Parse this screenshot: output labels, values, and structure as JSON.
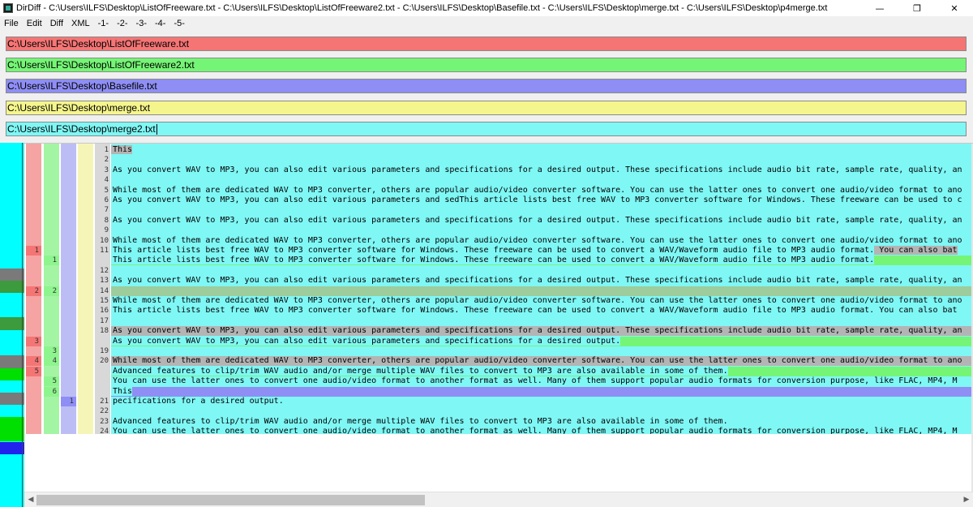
{
  "window": {
    "title": "DirDiff - C:\\Users\\ILFS\\Desktop\\ListOfFreeware.txt - C:\\Users\\ILFS\\Desktop\\ListOfFreeware2.txt - C:\\Users\\ILFS\\Desktop\\Basefile.txt - C:\\Users\\ILFS\\Desktop\\merge.txt - C:\\Users\\ILFS\\Desktop\\p4merge.txt",
    "minimize": "—",
    "restore": "❐",
    "close": "✕"
  },
  "menu": {
    "file": "File",
    "edit": "Edit",
    "diff": "Diff",
    "xml": "XML",
    "m1": "-1-",
    "m2": "-2-",
    "m3": "-3-",
    "m4": "-4-",
    "m5": "-5-"
  },
  "paths": {
    "p1": "C:\\Users\\ILFS\\Desktop\\ListOfFreeware.txt",
    "p2": "C:\\Users\\ILFS\\Desktop\\ListOfFreeware2.txt",
    "p3": "C:\\Users\\ILFS\\Desktop\\Basefile.txt",
    "p4": "C:\\Users\\ILFS\\Desktop\\merge.txt",
    "p5": "C:\\Users\\ILFS\\Desktop\\merge2.txt"
  },
  "colors": {
    "file1": "#f57575",
    "file2": "#75f575",
    "file3": "#8e8ef5",
    "file4": "#f5f58e",
    "file5": "#7ff7f5"
  },
  "gutter1": [
    {
      "row": 10,
      "num": "1"
    },
    {
      "row": 14,
      "num": "2"
    },
    {
      "row": 19,
      "num": "3"
    },
    {
      "row": 21,
      "num": "4"
    },
    {
      "row": 22,
      "num": "5"
    }
  ],
  "gutter2": [
    {
      "row": 11,
      "num": "1"
    },
    {
      "row": 14,
      "num": "2"
    },
    {
      "row": 20,
      "num": "3"
    },
    {
      "row": 21,
      "num": "4"
    },
    {
      "row": 23,
      "num": "5"
    },
    {
      "row": 24,
      "num": "6"
    }
  ],
  "gutter3": [
    {
      "row": 25,
      "num": "1"
    }
  ],
  "lines": [
    {
      "n": "1",
      "text": "This",
      "style": "grey-short"
    },
    {
      "n": "2",
      "text": "",
      "style": "plain"
    },
    {
      "n": "3",
      "text": "As you convert WAV to MP3, you can also edit various parameters and specifications for a desired output. These specifications include audio bit rate, sample rate, quality, an",
      "style": "plain"
    },
    {
      "n": "4",
      "text": "",
      "style": "plain"
    },
    {
      "n": "5",
      "text": "While most of them are dedicated WAV to MP3 converter, others are popular audio/video converter software. You can use the latter ones to convert one audio/video format to ano",
      "style": "plain"
    },
    {
      "n": "6",
      "text": "As you convert WAV to MP3, you can also edit various parameters and sedThis article lists best free WAV to MP3 converter software for Windows. These freeware can be used to c",
      "style": "plain"
    },
    {
      "n": "7",
      "text": "",
      "style": "plain"
    },
    {
      "n": "8",
      "text": "As you convert WAV to MP3, you can also edit various parameters and specifications for a desired output. These specifications include audio bit rate, sample rate, quality, an",
      "style": "plain"
    },
    {
      "n": "9",
      "text": "",
      "style": "plain"
    },
    {
      "n": "10",
      "text": "While most of them are dedicated WAV to MP3 converter, others are popular audio/video converter software. You can use the latter ones to convert one audio/video format to ano",
      "style": "plain"
    },
    {
      "n": "11",
      "text": "This article lists best free WAV to MP3 converter software for Windows. These freeware can be used to convert a WAV/Waveform audio file to MP3 audio format.",
      "tail": " You can also bat",
      "style": "grey-tail"
    },
    {
      "n": "",
      "text": "This article lists best free WAV to MP3 converter software for Windows. These freeware can be used to convert a WAV/Waveform audio file to MP3 audio format.",
      "style": "green-tail"
    },
    {
      "n": "12",
      "text": "",
      "style": "plain"
    },
    {
      "n": "13",
      "text": "As you convert WAV to MP3, you can also edit various parameters and specifications for a desired output. These specifications include audio bit rate, sample rate, quality, an",
      "style": "plain"
    },
    {
      "n": "14",
      "text": "",
      "style": "sage"
    },
    {
      "n": "15",
      "text": "While most of them are dedicated WAV to MP3 converter, others are popular audio/video converter software. You can use the latter ones to convert one audio/video format to ano",
      "style": "plain"
    },
    {
      "n": "16",
      "text": "This article lists best free WAV to MP3 converter software for Windows. These freeware can be used to convert a WAV/Waveform audio file to MP3 audio format.",
      "tail": " You can also bat",
      "style": "plain"
    },
    {
      "n": "17",
      "text": "",
      "style": "plain"
    },
    {
      "n": "18",
      "text": "As you convert WAV to MP3, you can also edit various parameters and specifications for a desired output. These specifications include audio bit rate, sample rate, quality, an",
      "style": "grey"
    },
    {
      "n": "",
      "text": "As you convert WAV to MP3, you can also edit various parameters and specifications for a desired output.",
      "style": "green-after"
    },
    {
      "n": "19",
      "text": "",
      "style": "plain"
    },
    {
      "n": "20",
      "text": "While most of them are dedicated WAV to MP3 converter, others are popular audio/video converter software. You can use the latter ones to convert one audio/video format to ano",
      "style": "grey"
    },
    {
      "n": "",
      "text": "Advanced features to clip/trim WAV audio and/or merge multiple WAV files to convert to MP3 are also available in some of them.",
      "style": "green-after"
    },
    {
      "n": "",
      "text": "You can use the latter ones to convert one audio/video format to another format as well. Many of them support popular audio formats for conversion purpose, like FLAC, MP4, M",
      "style": "plain"
    },
    {
      "n": "",
      "text": "This",
      "style": "blue-after"
    },
    {
      "n": "21",
      "text": "pecifications for a desired output.",
      "style": "plain"
    },
    {
      "n": "22",
      "text": "",
      "style": "plain"
    },
    {
      "n": "23",
      "text": "Advanced features to clip/trim WAV audio and/or merge multiple WAV files to convert to MP3 are also available in some of them.",
      "style": "plain"
    },
    {
      "n": "24",
      "text": "You can use the latter ones to convert one audio/video format to another format as well. Many of them support popular audio formats for conversion purpose, like FLAC, MP4, M",
      "style": "plain"
    }
  ]
}
